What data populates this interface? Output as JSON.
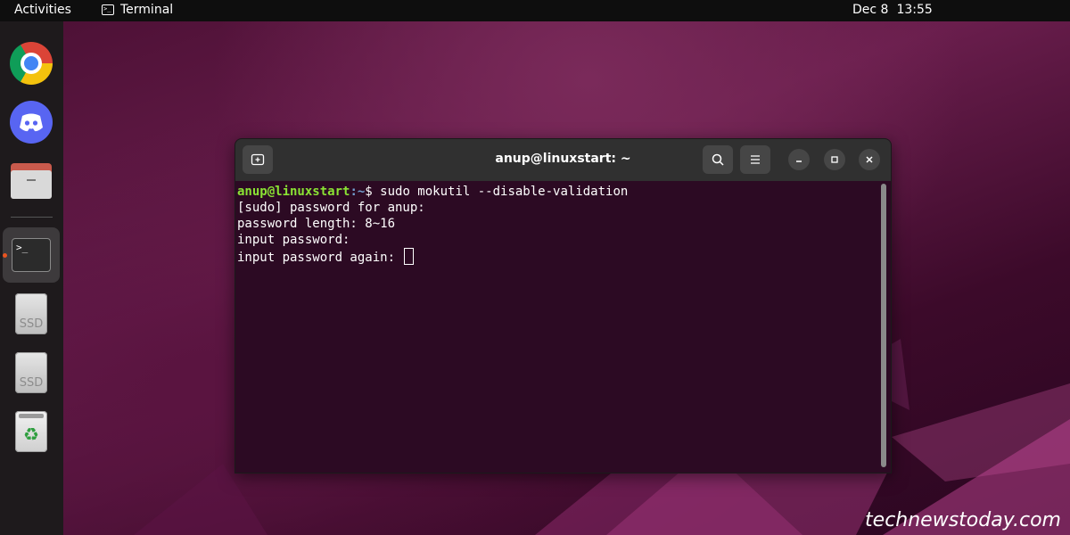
{
  "topbar": {
    "activities": "Activities",
    "app_name": "Terminal",
    "date": "Dec 8",
    "time": "13:55"
  },
  "dock": {
    "items": [
      {
        "name": "Google Chrome",
        "icon": "chrome-icon"
      },
      {
        "name": "Discord",
        "icon": "discord-icon"
      },
      {
        "name": "Files",
        "icon": "files-icon"
      },
      {
        "name": "Terminal",
        "icon": "terminal-icon",
        "active": true
      },
      {
        "name": "SSD",
        "icon": "drive-icon",
        "label": "SSD"
      },
      {
        "name": "SSD",
        "icon": "drive-icon",
        "label": "SSD"
      },
      {
        "name": "Trash",
        "icon": "trash-icon"
      }
    ]
  },
  "terminal": {
    "title": "anup@linuxstart: ~",
    "prompt_user": "anup@linuxstart",
    "prompt_path": ":~",
    "prompt_symbol": "$ ",
    "command": "sudo mokutil --disable-validation",
    "lines": [
      "[sudo] password for anup:",
      "password length: 8~16",
      "input password:",
      "input password again: "
    ]
  },
  "watermark": "technewstoday.com",
  "colors": {
    "prompt_user": "#8ae234",
    "prompt_path": "#729fcf",
    "terminal_bg": "#2c0a23",
    "titlebar_bg": "#303030",
    "accent": "#e95420"
  }
}
